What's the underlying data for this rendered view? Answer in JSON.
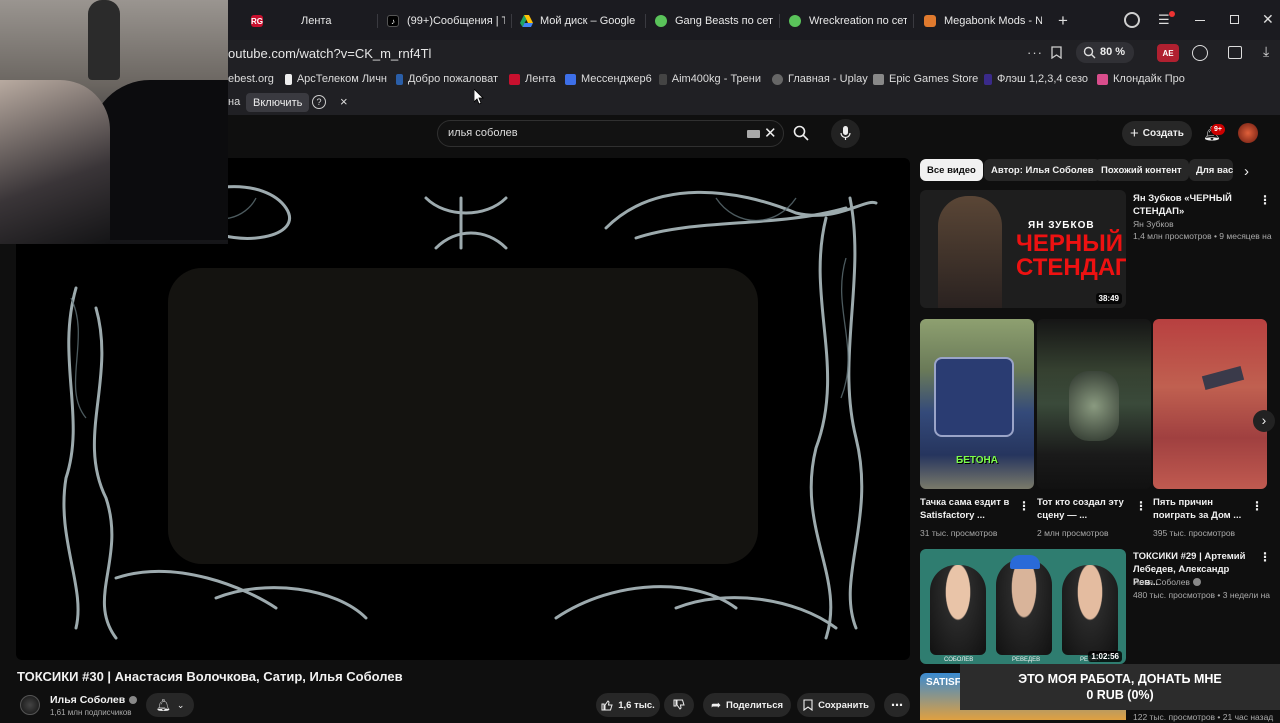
{
  "browser": {
    "tabs": [
      {
        "label": "Лента",
        "icon": "rg-icon",
        "color": "#c8102e"
      },
      {
        "label": "(99+)Сообщения | T",
        "icon": "tiktok-icon",
        "color": "#111111"
      },
      {
        "label": "Мой диск – Google",
        "icon": "google-drive-icon",
        "color": "#1fa463"
      },
      {
        "label": "Gang Beasts по сет",
        "icon": "gamepad-icon",
        "color": "#5ac35a"
      },
      {
        "label": "Wreckreation по сет",
        "icon": "gamepad-icon",
        "color": "#5ac35a"
      },
      {
        "label": "Megabonk Mods - N",
        "icon": "mod-icon",
        "color": "#e07a2e"
      }
    ],
    "address": "outube.com/watch?v=CK_m_rnf4Tl",
    "zoom": "80 %",
    "profile_badge": "AE",
    "bookmarks": [
      "ebest.org",
      "АрсТелеком Личн",
      "Добро пожаловат",
      "Лента",
      "Мессенджер6",
      "Aim400kg - Трени",
      "Главная - Uplay",
      "Epic Games Store",
      "Флэш 1,2,3,4 сезо",
      "Клондайк Про"
    ],
    "notice": {
      "text": "на",
      "enable": "Включить",
      "help": "?",
      "close": "×"
    }
  },
  "youtube": {
    "search_value": "илья соболев",
    "create_label": "Создать",
    "notif_count": "9+",
    "chips": [
      "Все видео",
      "Автор: Илья Соболев",
      "Похожий контент",
      "Для вас"
    ],
    "rec1": {
      "title": "Ян Зубков «ЧЕРНЫЙ СТЕНДАП»",
      "channel": "Ян Зубков",
      "stats": "1,4 млн просмотров • 9 месяцев на",
      "duration": "38:49",
      "thumb_line1": "ЯН ЗУБКОВ",
      "thumb_line2": "ЧЕРНЫЙ",
      "thumb_line3": "СТЕНДАП"
    },
    "shorts": [
      {
        "title": "Тачка сама ездит в Satisfactory ...",
        "views": "31 тыс. просмотров",
        "thumb_text": "БЕТОНА"
      },
      {
        "title": "Тот кто создал эту сцену — ...",
        "views": "2 млн просмотров"
      },
      {
        "title": "Пять причин поиграть за Дом ...",
        "views": "395 тыс. просмотров"
      }
    ],
    "rec2": {
      "title": "ТОКСИКИ #29 | Артемий Лебедев, Александр Рев...",
      "channel": "Илья Соболев",
      "stats": "480 тыс. просмотров • 3 недели на",
      "duration": "1:02:56",
      "name1": "СОБОЛЕВ",
      "name2": "РЕВЕДЕВ",
      "name3": "РЕВВА"
    },
    "rec3": {
      "thumb_text": "SATISFAC",
      "stats": "122 тыс. просмотров • 21 час назад"
    },
    "video": {
      "title": "ТОКСИКИ #30 | Анастасия Волочкова, Сатир, Илья Соболев",
      "channel": "Илья Соболев",
      "subs": "1,61 млн подписчиков",
      "likes": "1,6 тыс.",
      "share": "Поделиться",
      "save": "Сохранить"
    },
    "donation": {
      "line1": "ЭТО МОЯ РАБОТА, ДОНАТЬ МНЕ",
      "line2": "0 RUB (0%)"
    }
  }
}
